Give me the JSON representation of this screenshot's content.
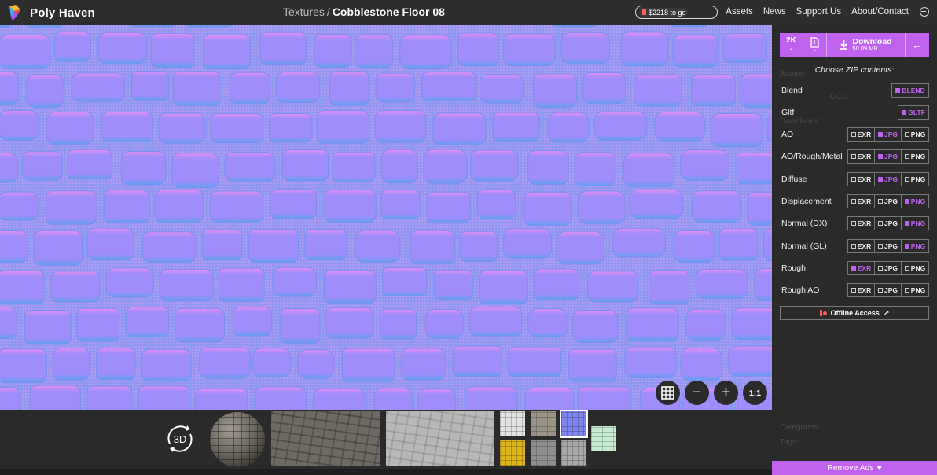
{
  "header": {
    "brand": "Poly Haven",
    "breadcrumb": {
      "section": "Textures",
      "separator": "/",
      "title": "Cobblestone Floor 08"
    },
    "funding": {
      "label": "$2218 to go"
    },
    "nav": [
      "Assets",
      "News",
      "Support Us",
      "About/Contact"
    ],
    "icons": {
      "logo": "poly-haven-logo",
      "login": "login-icon"
    }
  },
  "viewer": {
    "controls": {
      "tile_icon": "grid-icon",
      "zoom_out": "−",
      "zoom_in": "+",
      "one_to_one": "1:1"
    },
    "colors": {
      "base": "#8b86f7",
      "stone_top": "#9f8dfb",
      "stone_edge_hi": "#e38ff5",
      "stone_edge_lo": "#5fa0f0",
      "grout": "#9a97f2"
    }
  },
  "strip": {
    "btn_3d_label": "3D",
    "map_thumbs": [
      {
        "name": "map-thumb-diffuse-white",
        "color": "#e2e2e2"
      },
      {
        "name": "map-thumb-ao",
        "color": "#9a9486"
      },
      {
        "name": "map-thumb-normal",
        "color": "#7f85ef",
        "active": true
      },
      {
        "name": "map-thumb-yellow",
        "color": "#dcb41c"
      },
      {
        "name": "map-thumb-rough",
        "color": "#8f8f8f"
      },
      {
        "name": "map-thumb-gray",
        "color": "#a8a8a8"
      },
      {
        "name": "map-thumb-green",
        "color": "#c8ecd2"
      }
    ]
  },
  "panel": {
    "download": {
      "resolution": "2K",
      "label": "Download",
      "size": "50.09 MB"
    },
    "zip_title": "Choose ZIP contents:",
    "rows": [
      {
        "label": "Blend",
        "opts": [
          {
            "text": "BLEND",
            "on": true
          }
        ]
      },
      {
        "label": "Gltf",
        "opts": [
          {
            "text": "GLTF",
            "on": true
          }
        ]
      },
      {
        "label": "AO",
        "opts": [
          {
            "text": "EXR",
            "on": false
          },
          {
            "text": "JPG",
            "on": true
          },
          {
            "text": "PNG",
            "on": false
          }
        ]
      },
      {
        "label": "AO/Rough/Metal",
        "opts": [
          {
            "text": "EXR",
            "on": false
          },
          {
            "text": "JPG",
            "on": true
          },
          {
            "text": "PNG",
            "on": false
          }
        ]
      },
      {
        "label": "Diffuse",
        "opts": [
          {
            "text": "EXR",
            "on": false
          },
          {
            "text": "JPG",
            "on": true
          },
          {
            "text": "PNG",
            "on": false
          }
        ]
      },
      {
        "label": "Displacement",
        "opts": [
          {
            "text": "EXR",
            "on": false
          },
          {
            "text": "JPG",
            "on": false
          },
          {
            "text": "PNG",
            "on": true
          }
        ]
      },
      {
        "label": "Normal (DX)",
        "opts": [
          {
            "text": "EXR",
            "on": false
          },
          {
            "text": "JPG",
            "on": false
          },
          {
            "text": "PNG",
            "on": true
          }
        ]
      },
      {
        "label": "Normal (GL)",
        "opts": [
          {
            "text": "EXR",
            "on": false
          },
          {
            "text": "JPG",
            "on": false
          },
          {
            "text": "PNG",
            "on": true
          }
        ]
      },
      {
        "label": "Rough",
        "opts": [
          {
            "text": "EXR",
            "on": true
          },
          {
            "text": "JPG",
            "on": false
          },
          {
            "text": "PNG",
            "on": false
          }
        ]
      },
      {
        "label": "Rough AO",
        "opts": [
          {
            "text": "EXR",
            "on": false
          },
          {
            "text": "JPG",
            "on": false
          },
          {
            "text": "PNG",
            "on": false
          }
        ]
      }
    ],
    "offline_label": "Offline Access",
    "ghost": {
      "author": "Author:",
      "license": "CC0",
      "downloads": "Downloads:",
      "categories": "Categories:",
      "tags": "Tags:"
    },
    "remove_ads": "Remove Ads"
  },
  "accent": "#c062f0"
}
